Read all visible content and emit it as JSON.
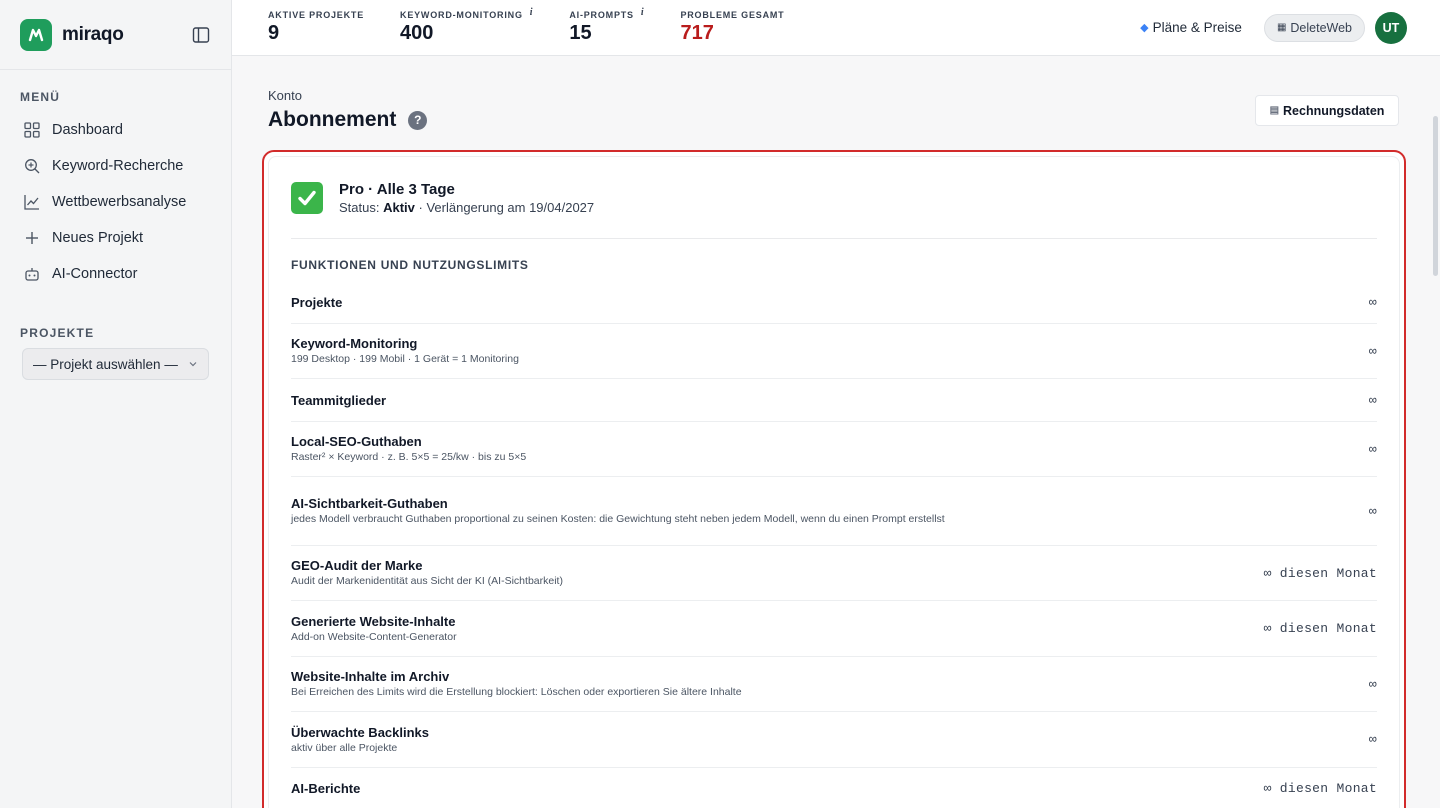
{
  "brand": {
    "name": "miraqo",
    "color": "#1f9d5c"
  },
  "sidebar": {
    "menu_title": "MENÜ",
    "items": [
      {
        "label": "Dashboard",
        "icon": "grid-icon"
      },
      {
        "label": "Keyword-Recherche",
        "icon": "search-icon"
      },
      {
        "label": "Wettbewerbsanalyse",
        "icon": "chart-icon"
      },
      {
        "label": "Neues Projekt",
        "icon": "plus-icon"
      },
      {
        "label": "AI-Connector",
        "icon": "robot-icon"
      }
    ],
    "projects_title": "PROJEKTE",
    "project_select": "— Projekt auswählen —"
  },
  "topbar": {
    "stats": [
      {
        "label": "AKTIVE PROJEKTE",
        "value": "9",
        "info": ""
      },
      {
        "label": "KEYWORD-MONITORING",
        "value": "400",
        "info": "i"
      },
      {
        "label": "AI-PROMPTS",
        "value": "15",
        "info": "i"
      },
      {
        "label": "PROBLEME GESAMT",
        "value": "717",
        "info": ""
      }
    ],
    "plans_label": "Pläne & Preise",
    "account_label": "DeleteWeb",
    "avatar": "UT"
  },
  "page": {
    "breadcrumb": "Konto",
    "title": "Abonnement",
    "help": "?",
    "billing_button": "Rechnungsdaten"
  },
  "plan": {
    "name": "Pro · Alle 3 Tage",
    "status_label": "Status:",
    "status_value": "Aktiv",
    "renewal": "· Verlängerung am 19/04/2027",
    "status_color": "#3bb54a"
  },
  "features": {
    "section_title": "FUNKTIONEN UND NUTZUNGSLIMITS",
    "rows": [
      {
        "name": "Projekte",
        "desc": "",
        "value": "∞"
      },
      {
        "name": "Keyword-Monitoring",
        "desc": "199 Desktop · 199 Mobil · 1 Gerät = 1 Monitoring",
        "value": "∞"
      },
      {
        "name": "Teammitglieder",
        "desc": "",
        "value": "∞"
      },
      {
        "name": "Local-SEO-Guthaben",
        "desc": "Raster² × Keyword · z. B. 5×5 = 25/kw · bis zu 5×5",
        "value": "∞"
      },
      {
        "name": "AI-Sichtbarkeit-Guthaben",
        "desc": "jedes Modell verbraucht Guthaben proportional zu seinen Kosten: die Gewichtung steht neben jedem Modell, wenn du einen Prompt erstellst",
        "value": "∞"
      },
      {
        "name": "GEO-Audit der Marke",
        "desc": "Audit der Markenidentität aus Sicht der KI (AI-Sichtbarkeit)",
        "value": "∞ diesen Monat"
      },
      {
        "name": "Generierte Website-Inhalte",
        "desc": "Add-on Website-Content-Generator",
        "value": "∞ diesen Monat"
      },
      {
        "name": "Website-Inhalte im Archiv",
        "desc": "Bei Erreichen des Limits wird die Erstellung blockiert: Löschen oder exportieren Sie ältere Inhalte",
        "value": "∞"
      },
      {
        "name": "Überwachte Backlinks",
        "desc": "aktiv über alle Projekte",
        "value": "∞"
      },
      {
        "name": "AI-Berichte",
        "desc": "",
        "value": "∞ diesen Monat"
      }
    ]
  }
}
